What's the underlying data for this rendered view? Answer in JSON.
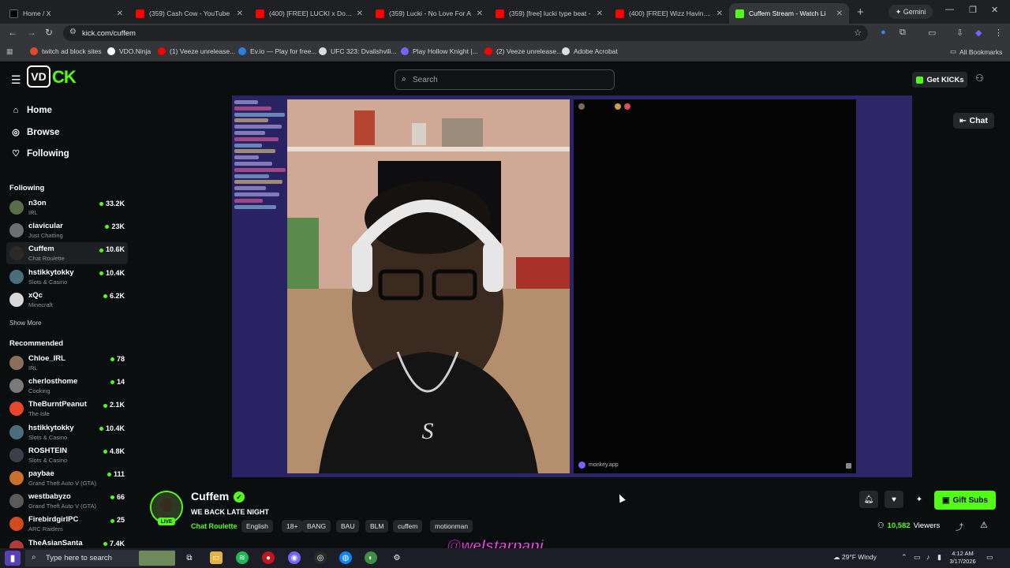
{
  "browser": {
    "tabs": [
      {
        "title": "Home / X",
        "favicon_color": "#000000",
        "favicon_glyph": "X"
      },
      {
        "title": "(359) Cash Cow - YouTube",
        "favicon_color": "#ff0000"
      },
      {
        "title": "(400) [FREE] LUCKI x Dopamine",
        "favicon_color": "#ff0000"
      },
      {
        "title": "(359) Lucki - No Love For A",
        "favicon_color": "#ff0000"
      },
      {
        "title": "(359) [free] lucki type beat -",
        "favicon_color": "#ff0000"
      },
      {
        "title": "(400) [FREE] Wizz Havinn Typ",
        "favicon_color": "#ff0000"
      },
      {
        "title": "Cuffem Stream - Watch Li",
        "favicon_color": "#53fc18",
        "active": true
      }
    ],
    "gemini_label": "Gemini",
    "url": "kick.com/cuffem",
    "bookmarks": [
      {
        "label": "twitch ad block sites",
        "color": "#e2492f"
      },
      {
        "label": "VDO.Ninja",
        "color": "#ffffff"
      },
      {
        "label": "(1) Veeze unrelease...",
        "color": "#ff0000"
      },
      {
        "label": "Ev.io — Play for free...",
        "color": "#2f7de1"
      },
      {
        "label": "UFC 323: Dvalishvili...",
        "color": "#dddddd"
      },
      {
        "label": "Play Hollow Knight |...",
        "color": "#7b61ff"
      },
      {
        "label": "(2) Veeze unrelease...",
        "color": "#ff0000"
      },
      {
        "label": "Adobe Acrobat",
        "color": "#dddddd"
      }
    ],
    "all_bookmarks": "All Bookmarks"
  },
  "kick": {
    "logo_text": "VD",
    "logo_ck": "CK",
    "search_placeholder": "Search",
    "get_kicks": "Get KICKs",
    "nav": [
      {
        "label": "Home",
        "icon": "home-icon"
      },
      {
        "label": "Browse",
        "icon": "compass-icon"
      },
      {
        "label": "Following",
        "icon": "heart-icon"
      }
    ],
    "following_header": "Following",
    "following": [
      {
        "name": "n3on",
        "category": "IRL",
        "viewers": "33.2K",
        "color": "#5c6b4a"
      },
      {
        "name": "clavicular",
        "category": "Just Chatting",
        "viewers": "23K",
        "color": "#6b6f73"
      },
      {
        "name": "Cuffem",
        "category": "Chat Roulette",
        "viewers": "10.6K",
        "color": "#2d2a26",
        "selected": true
      },
      {
        "name": "hstikkytokky",
        "category": "Slots & Casino",
        "viewers": "10.4K",
        "color": "#4a6f7a"
      },
      {
        "name": "xQc",
        "category": "Minecraft",
        "viewers": "6.2K",
        "color": "#d9d9d9"
      }
    ],
    "show_more": "Show More",
    "recommended_header": "Recommended",
    "recommended": [
      {
        "name": "Chloe_IRL",
        "category": "IRL",
        "viewers": "78",
        "color": "#8a6d5a"
      },
      {
        "name": "cherlosthome",
        "category": "Cooking",
        "viewers": "14",
        "color": "#7a7a7a"
      },
      {
        "name": "TheBurntPeanut",
        "category": "The Isle",
        "viewers": "2.1K",
        "color": "#e8472a"
      },
      {
        "name": "hstikkytokky",
        "category": "Slots & Casino",
        "viewers": "10.4K",
        "color": "#4a6f7a"
      },
      {
        "name": "ROSHTEIN",
        "category": "Slots & Casino",
        "viewers": "4.8K",
        "color": "#3a3f4a"
      },
      {
        "name": "paybae",
        "category": "Grand Theft Auto V (GTA)",
        "viewers": "111",
        "color": "#c9702a"
      },
      {
        "name": "westbabyzo",
        "category": "Grand Theft Auto V (GTA)",
        "viewers": "66",
        "color": "#5a5a5a"
      },
      {
        "name": "FirebirdgirlPC",
        "category": "ARC Raiders",
        "viewers": "25",
        "color": "#d44a1f"
      },
      {
        "name": "TheAsianSanta",
        "category": "",
        "viewers": "7.4K",
        "color": "#b33a3a"
      }
    ],
    "chat_button": "Chat",
    "peer_label": "monkey.app",
    "stream": {
      "channel": "Cuffem",
      "title": "WE BACK LATE NIGHT",
      "category": "Chat Roulette",
      "tags": [
        "English",
        "18+",
        "BANG",
        "BAU",
        "BLM",
        "cuffem",
        "motionman"
      ],
      "live_label": "LIVE",
      "gift_subs": "Gift Subs",
      "viewers_count": "10,582",
      "viewers_label": "Viewers"
    },
    "watermark": "@welstarpapi"
  },
  "taskbar": {
    "search_placeholder": "Type here to search",
    "weather": "29°F Windy",
    "time": "4:12 AM",
    "date": "3/17/2026"
  }
}
